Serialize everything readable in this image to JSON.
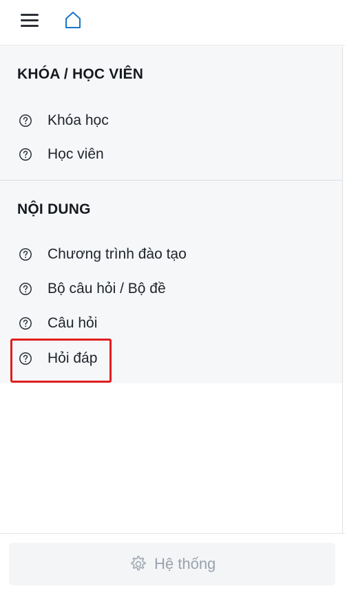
{
  "header": {
    "menu_icon": "hamburger-menu-icon",
    "home_icon": "home-icon"
  },
  "sections": [
    {
      "title": "KHÓA / HỌC VIÊN",
      "items": [
        {
          "label": "Khóa học",
          "icon": "question-circle-icon"
        },
        {
          "label": "Học viên",
          "icon": "question-circle-icon"
        }
      ]
    },
    {
      "title": "NỘI DUNG",
      "items": [
        {
          "label": "Chương trình đào tạo",
          "icon": "question-circle-icon"
        },
        {
          "label": "Bộ câu hỏi / Bộ đề",
          "icon": "question-circle-icon"
        },
        {
          "label": "Câu hỏi",
          "icon": "question-circle-icon"
        },
        {
          "label": "Hỏi đáp",
          "icon": "question-circle-icon"
        }
      ]
    }
  ],
  "footer": {
    "system_label": "Hệ thống",
    "system_icon": "gear-icon"
  },
  "colors": {
    "highlight": "#e11d1d",
    "panel_bg": "#f6f7f9",
    "home_icon": "#1a73c9"
  }
}
